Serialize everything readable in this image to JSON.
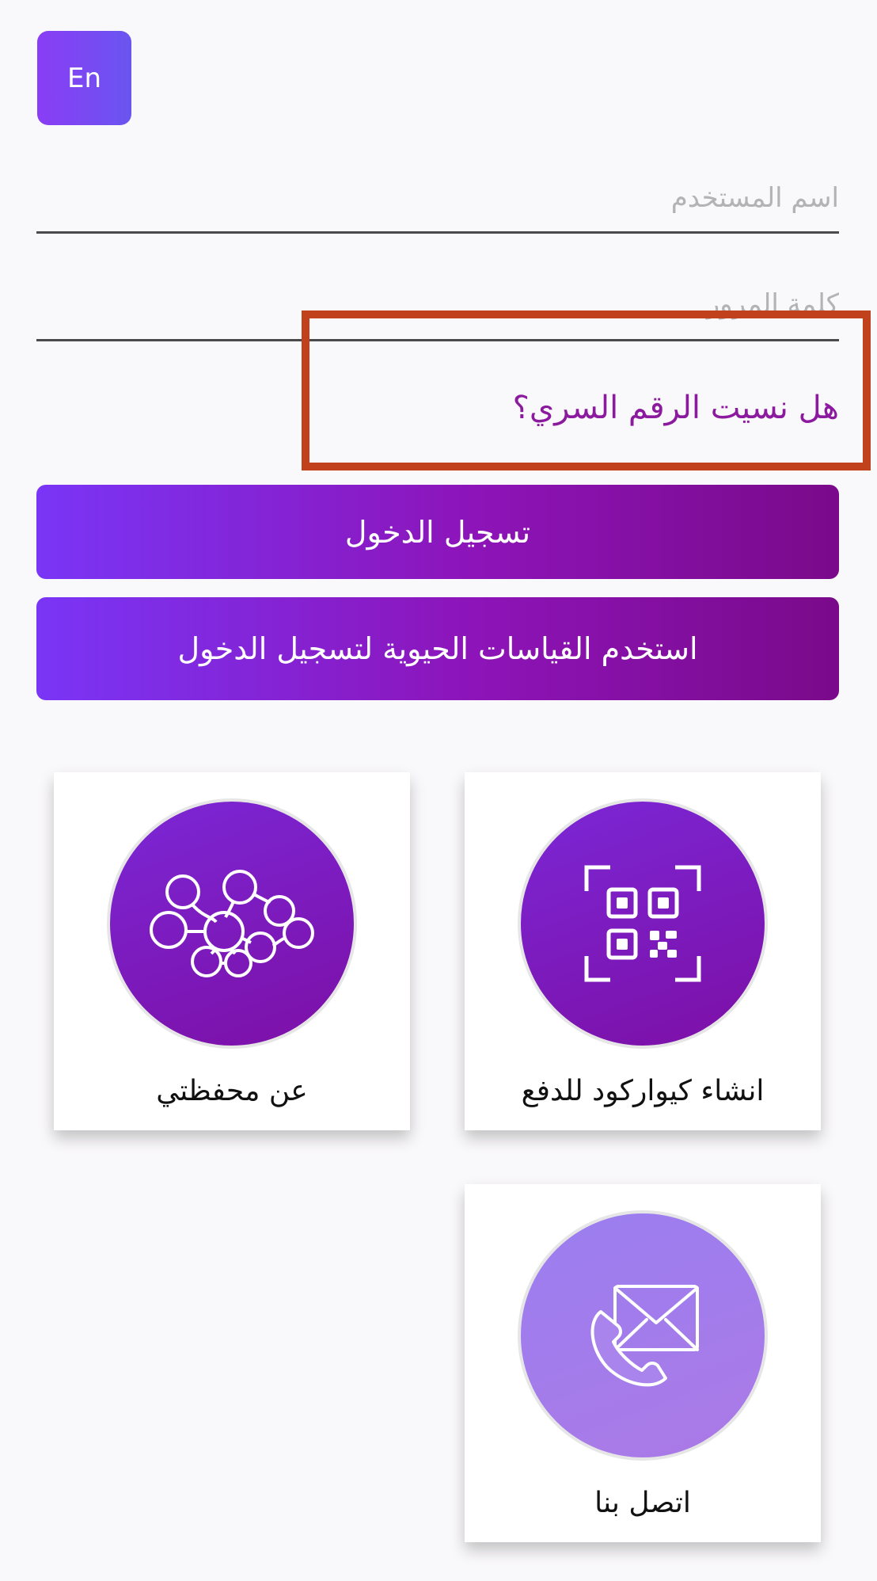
{
  "language_toggle": {
    "label": "En"
  },
  "form": {
    "username_placeholder": "اسم المستخدم",
    "password_placeholder": "كلمة المرور",
    "forgot_password": "هل نسيت الرقم السري؟",
    "login_button": "تسجيل الدخول",
    "biometric_button": "استخدم القياسات الحيوية لتسجيل الدخول"
  },
  "cards": [
    {
      "label": "عن محفظتي",
      "icon": "network-nodes-icon"
    },
    {
      "label": "انشاء كيواركود للدفع",
      "icon": "qr-code-icon"
    },
    {
      "label": "اتصل بنا",
      "icon": "mail-phone-icon"
    }
  ],
  "colors": {
    "accent_start": "#7a35f6",
    "accent_end": "#7a0a8a",
    "link": "#8b1a9e",
    "highlight": "#c0411c"
  }
}
